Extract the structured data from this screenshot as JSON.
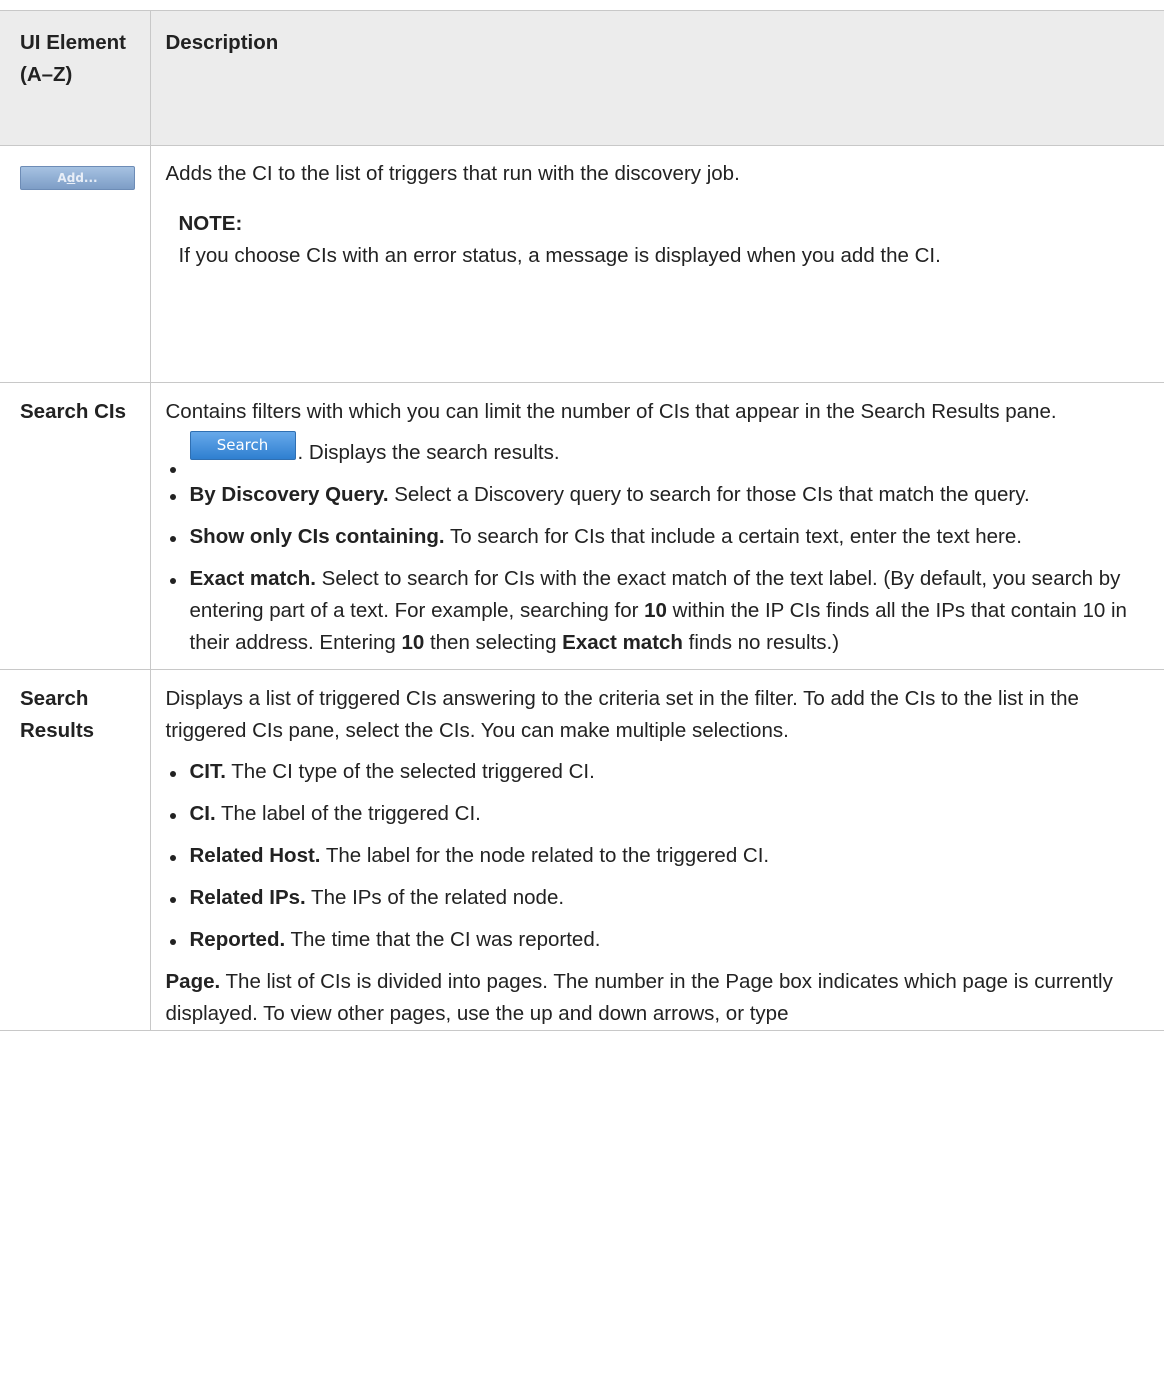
{
  "header": {
    "col1": "UI Element (A–Z)",
    "col2": "Description"
  },
  "rows": {
    "add": {
      "button_label_pre": "A",
      "button_label_mnemonic": "d",
      "button_label_post": "d...",
      "description": "Adds the CI to the list of triggers that run with the discovery job.",
      "note_label": "NOTE:",
      "note_text": "If you choose CIs with an error status, a message is displayed when you add the CI."
    },
    "search_cis": {
      "element": "Search CIs",
      "description": "Contains filters with which you can limit the number of CIs that appear in the Search Results pane.",
      "search_button_label": "Search",
      "search_button_desc": ". Displays the search results.",
      "items": [
        {
          "term": "By Discovery Query.",
          "text": " Select a Discovery query to search for those CIs that match the query."
        },
        {
          "term": "Show only CIs containing.",
          "text": " To search for CIs that include a certain text, enter the text here."
        }
      ],
      "exact": {
        "term": "Exact match.",
        "t1": " Select to search for CIs with the exact match of the text label. (By default, you search by entering part of a text. For example, searching for ",
        "b1": "10",
        "t2": " within the IP CIs finds all the IPs that contain 10 in their address. Entering ",
        "b2": "10",
        "t3": " then selecting ",
        "b3": "Exact match",
        "t4": " finds no results.)"
      }
    },
    "search_results": {
      "element": "Search Results",
      "description": "Displays a list of triggered CIs answering to the criteria set in the filter. To add the CIs to the list in the triggered CIs pane, select the CIs. You can make multiple selections.",
      "items": [
        {
          "term": "CIT.",
          "text": " The CI type of the selected triggered CI."
        },
        {
          "term": "CI.",
          "text": " The label of the triggered CI."
        },
        {
          "term": "Related Host.",
          "text": " The label for the node related to the triggered CI."
        },
        {
          "term": "Related IPs.",
          "text": " The IPs of the related node."
        },
        {
          "term": "Reported.",
          "text": " The time that the CI was reported."
        }
      ],
      "page_term": "Page.",
      "page_text": " The list of CIs is divided into pages. The number in the Page box indicates which page is currently displayed. To view other pages, use the up and down arrows, or type"
    }
  }
}
